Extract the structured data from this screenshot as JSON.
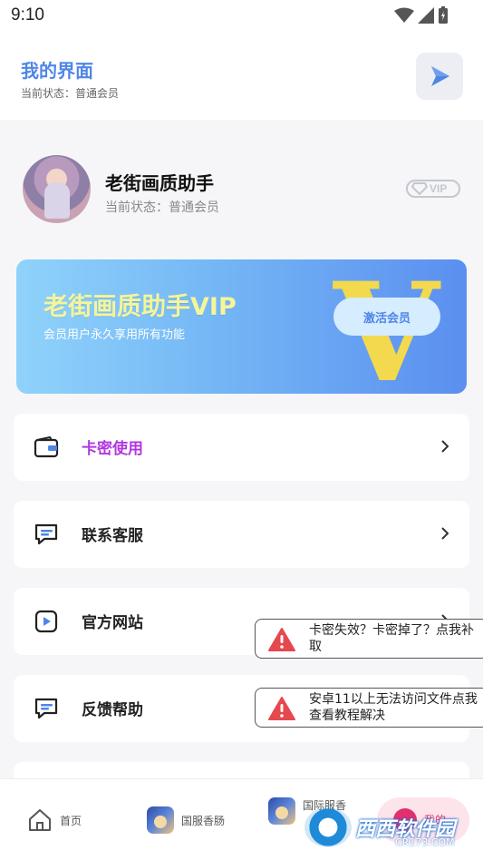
{
  "status_bar": {
    "time": "9:10"
  },
  "header": {
    "title": "我的界面",
    "subtitle": "当前状态：普通会员",
    "action_icon": "play-icon"
  },
  "profile": {
    "name": "老街画质助手",
    "status": "当前状态：普通会员",
    "badge": "VIP"
  },
  "banner": {
    "title": "老街画质助手VIP",
    "subtitle": "会员用户永久享用所有功能",
    "button": "激活会员",
    "big_letter": "V"
  },
  "menu": [
    {
      "label": "卡密使用",
      "icon": "wallet-icon"
    },
    {
      "label": "联系客服",
      "icon": "chat-icon"
    },
    {
      "label": "官方网站",
      "icon": "play-icon"
    },
    {
      "label": "反馈帮助",
      "icon": "chat-icon"
    }
  ],
  "toasts": [
    {
      "text": "卡密失效？卡密掉了？点我补取"
    },
    {
      "text": "安卓11以上无法访问文件点我查看教程解决"
    }
  ],
  "bottom_nav": [
    {
      "label": "首页",
      "icon": "home-icon"
    },
    {
      "label": "国服香肠",
      "icon": "game-icon"
    },
    {
      "label": "国际服香",
      "icon": "game-icon"
    },
    {
      "label": "我的",
      "icon": "user-icon"
    }
  ],
  "watermark": {
    "text": "西西软件园",
    "sub": "CR173.COM"
  },
  "colors": {
    "accent": "#4f86e6",
    "highlight": "#b236e0",
    "warning": "#e5484d",
    "me": "#e2306e"
  }
}
